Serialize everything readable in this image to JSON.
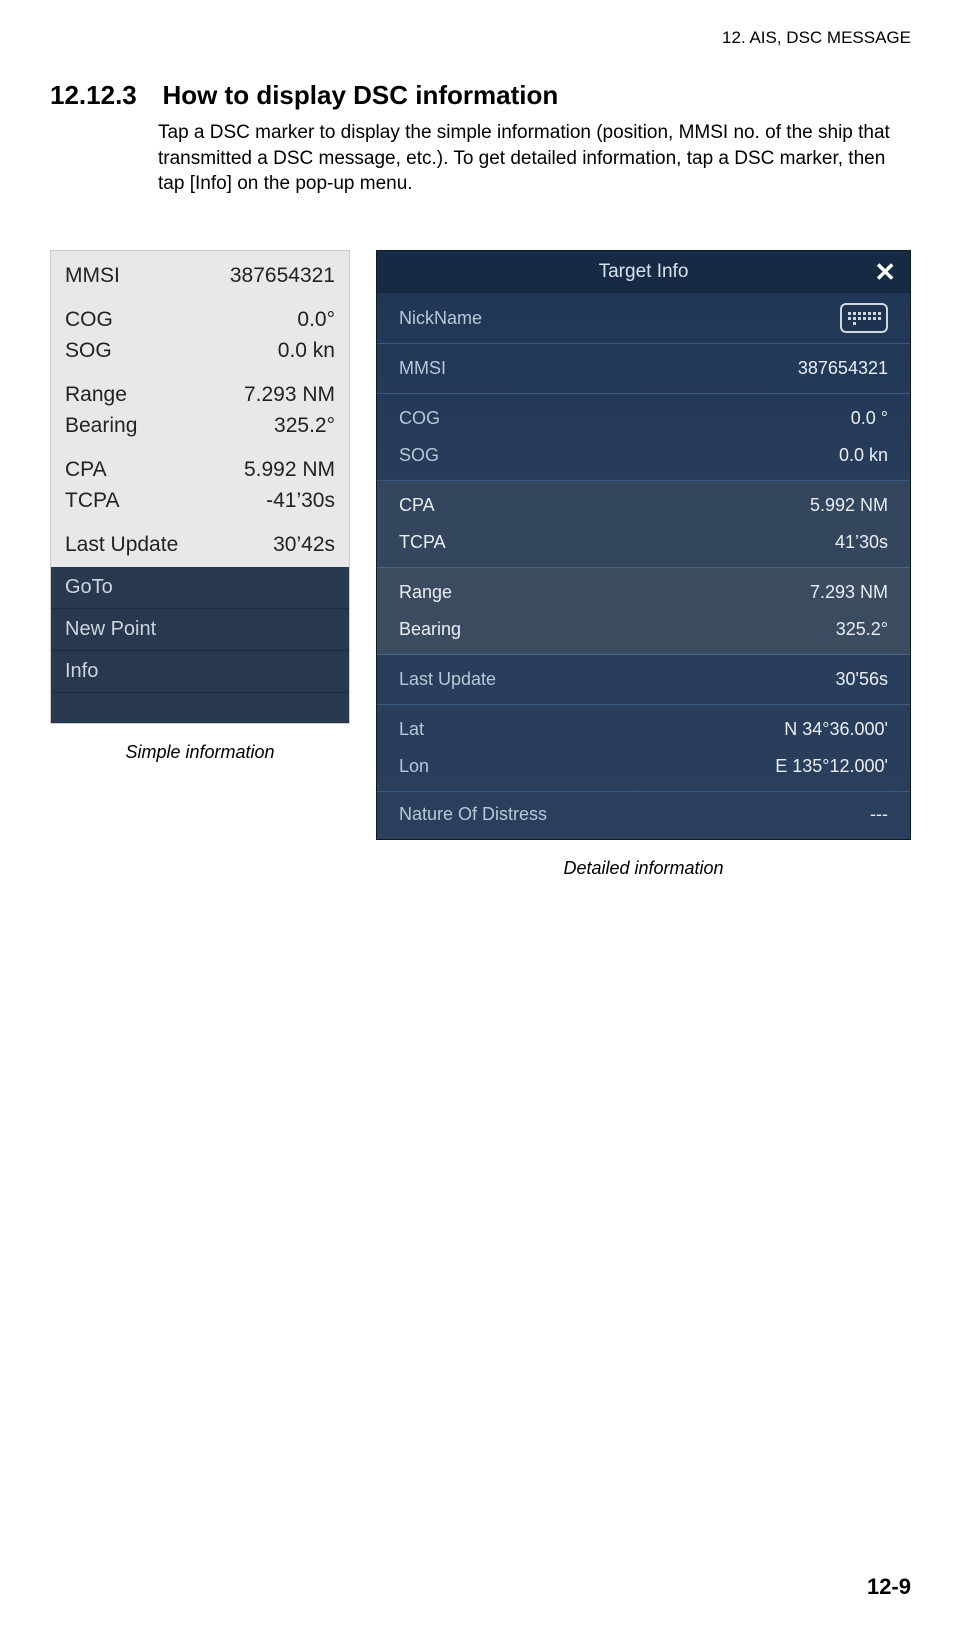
{
  "page": {
    "header": "12.  AIS, DSC MESSAGE",
    "section_number": "12.12.3",
    "section_title": "How to display DSC information",
    "body": "Tap a DSC marker to display the simple information (position, MMSI no. of the ship that transmitted a DSC message, etc.). To get detailed information, tap a DSC marker, then tap [Info] on the pop-up menu.",
    "page_number": "12-9"
  },
  "simple": {
    "caption": "Simple information",
    "rows": {
      "mmsi_label": "MMSI",
      "mmsi_value": "387654321",
      "cog_label": "COG",
      "cog_value": "0.0°",
      "sog_label": "SOG",
      "sog_value": "0.0 kn",
      "range_label": "Range",
      "range_value": "7.293 NM",
      "bearing_label": "Bearing",
      "bearing_value": "325.2°",
      "cpa_label": "CPA",
      "cpa_value": "5.992 NM",
      "tcpa_label": "TCPA",
      "tcpa_value": "-41’30s",
      "last_label": "Last Update",
      "last_value": "30’42s"
    },
    "menu": {
      "goto": "GoTo",
      "newpoint": "New Point",
      "info": "Info"
    }
  },
  "detail": {
    "caption": "Detailed information",
    "title": "Target Info",
    "nickname_label": "NickName",
    "rows": {
      "mmsi_label": "MMSI",
      "mmsi_value": "387654321",
      "cog_label": "COG",
      "cog_value": "0.0 °",
      "sog_label": "SOG",
      "sog_value": "0.0 kn",
      "cpa_label": "CPA",
      "cpa_value": "5.992 NM",
      "tcpa_label": "TCPA",
      "tcpa_value": "41’30s",
      "range_label": "Range",
      "range_value": "7.293 NM",
      "bearing_label": "Bearing",
      "bearing_value": "325.2°",
      "last_label": "Last Update",
      "last_value": "30'56s",
      "lat_label": "Lat",
      "lat_value": "N 34°36.000'",
      "lon_label": "Lon",
      "lon_value": "E 135°12.000'",
      "nod_label": "Nature Of Distress",
      "nod_value": "---"
    }
  }
}
